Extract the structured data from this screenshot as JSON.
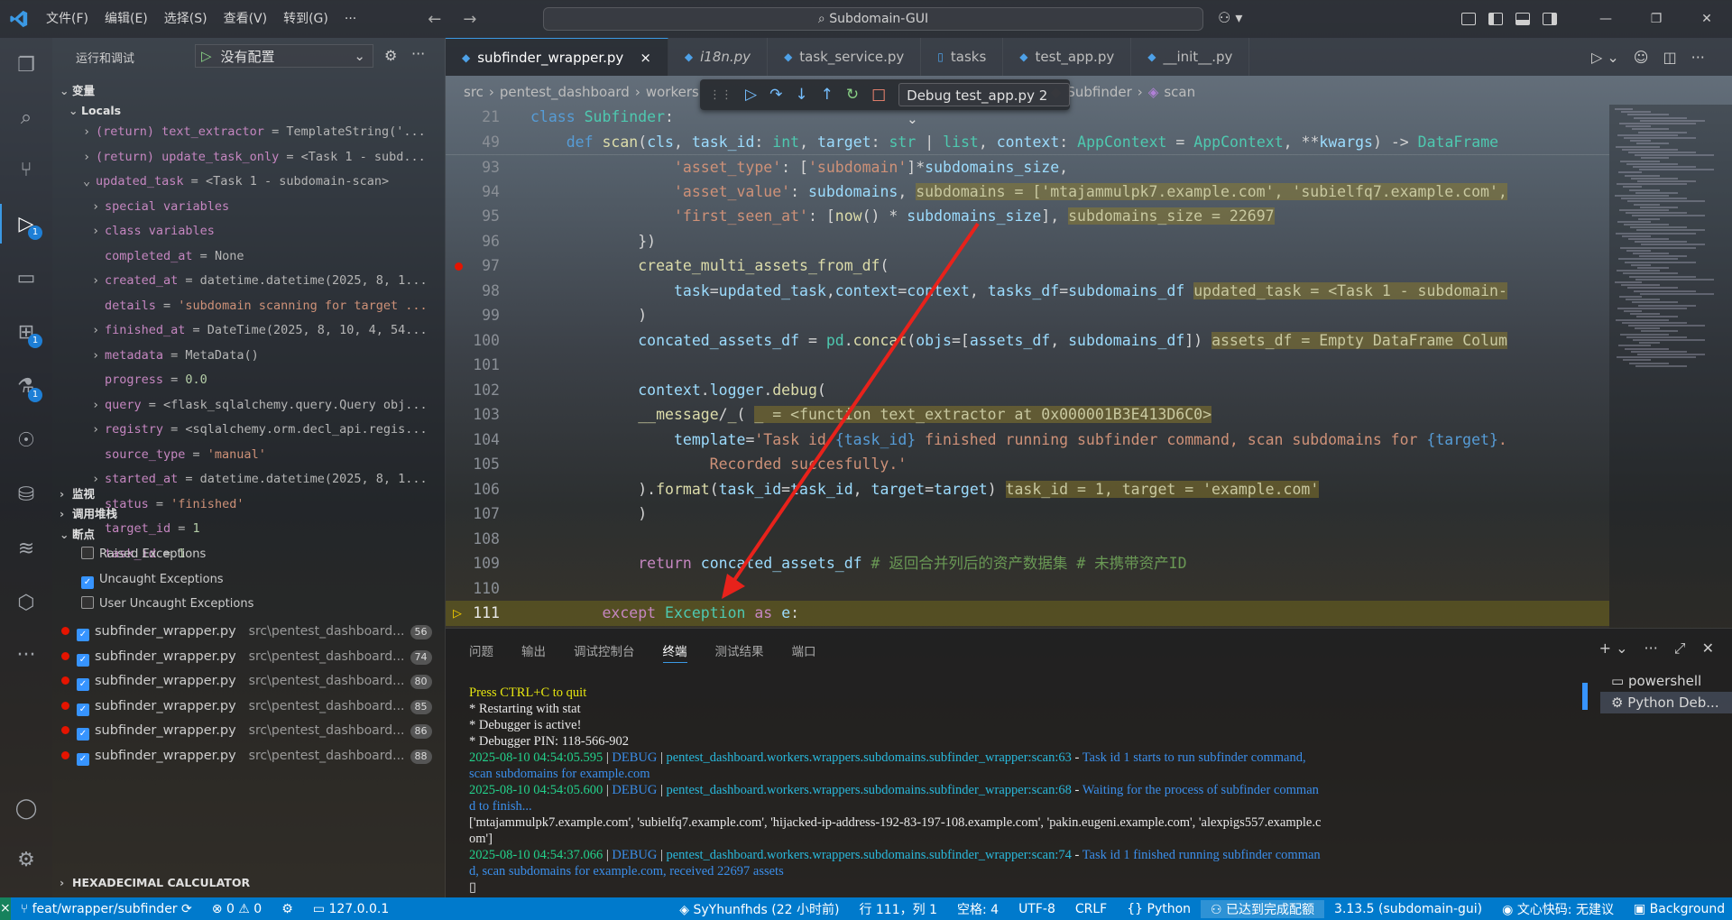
{
  "titlebar": {
    "menu": [
      "文件(F)",
      "编辑(E)",
      "选择(S)",
      "查看(V)",
      "转到(G)",
      "···"
    ],
    "search_text": "Subdomain-GUI"
  },
  "sidebar": {
    "header": "运行和调试",
    "config": "没有配置",
    "variables_section": "变量",
    "locals_label": "Locals",
    "locals": [
      {
        "name": "(return) text_extractor",
        "value": "TemplateString('...",
        "expandable": true,
        "indent": 1
      },
      {
        "name": "(return) update_task_only",
        "value": "<Task 1 - subd...",
        "expandable": true,
        "indent": 1
      },
      {
        "name": "updated_task",
        "value": "<Task 1 - subdomain-scan>",
        "expandable": true,
        "expanded": true,
        "indent": 1
      },
      {
        "name": "special variables",
        "value": "",
        "expandable": true,
        "indent": 2
      },
      {
        "name": "class variables",
        "value": "",
        "expandable": true,
        "indent": 2
      },
      {
        "name": "completed_at",
        "value": "None",
        "expandable": false,
        "indent": 2
      },
      {
        "name": "created_at",
        "value": "datetime.datetime(2025, 8, 1...",
        "expandable": true,
        "indent": 2
      },
      {
        "name": "details",
        "value": "'subdomain scanning for target ...",
        "expandable": false,
        "indent": 2
      },
      {
        "name": "finished_at",
        "value": "DateTime(2025, 8, 10, 4, 54...",
        "expandable": true,
        "indent": 2
      },
      {
        "name": "metadata",
        "value": "MetaData()",
        "expandable": true,
        "indent": 2
      },
      {
        "name": "progress",
        "value": "0.0",
        "expandable": false,
        "indent": 2
      },
      {
        "name": "query",
        "value": "<flask_sqlalchemy.query.Query obj...",
        "expandable": true,
        "indent": 2
      },
      {
        "name": "registry",
        "value": "<sqlalchemy.orm.decl_api.regis...",
        "expandable": true,
        "indent": 2
      },
      {
        "name": "source_type",
        "value": "'manual'",
        "expandable": false,
        "indent": 2
      },
      {
        "name": "started_at",
        "value": "datetime.datetime(2025, 8, 1...",
        "expandable": true,
        "indent": 2
      },
      {
        "name": "status",
        "value": "'finished'",
        "expandable": false,
        "indent": 2
      },
      {
        "name": "target_id",
        "value": "1",
        "expandable": false,
        "indent": 2
      },
      {
        "name": "task_id",
        "value": "1",
        "expandable": false,
        "indent": 2
      }
    ],
    "watch_section": "监视",
    "callstack_section": "调用堆栈",
    "breakpoints_section": "断点",
    "exception_options": [
      {
        "label": "Raised Exceptions",
        "checked": false
      },
      {
        "label": "Uncaught Exceptions",
        "checked": true
      },
      {
        "label": "User Uncaught Exceptions",
        "checked": false
      }
    ],
    "breakpoints": [
      {
        "file": "subfinder_wrapper.py",
        "path": "src\\pentest_dashboard...",
        "line": "56"
      },
      {
        "file": "subfinder_wrapper.py",
        "path": "src\\pentest_dashboard...",
        "line": "74"
      },
      {
        "file": "subfinder_wrapper.py",
        "path": "src\\pentest_dashboard...",
        "line": "80"
      },
      {
        "file": "subfinder_wrapper.py",
        "path": "src\\pentest_dashboard...",
        "line": "85"
      },
      {
        "file": "subfinder_wrapper.py",
        "path": "src\\pentest_dashboard...",
        "line": "86"
      },
      {
        "file": "subfinder_wrapper.py",
        "path": "src\\pentest_dashboard...",
        "line": "88"
      }
    ],
    "hex_section": "HEXADECIMAL CALCULATOR"
  },
  "activity_badges": {
    "debug": "1",
    "extensions": "1",
    "testing": "1"
  },
  "tabs": [
    {
      "label": "subfinder_wrapper.py",
      "active": true,
      "close": "×"
    },
    {
      "label": "i18n.py",
      "active": false
    },
    {
      "label": "task_service.py",
      "active": false
    },
    {
      "label": "tasks",
      "active": false
    },
    {
      "label": "test_app.py",
      "active": false
    },
    {
      "label": "__init__.py",
      "active": false
    }
  ],
  "breadcrumb": {
    "parts": [
      "src",
      "pentest_dashboard",
      "workers"
    ],
    "tail": [
      "Subfinder",
      "scan"
    ]
  },
  "debug_toolbar": {
    "config": "Debug test_app.py 2"
  },
  "code_lines": [
    {
      "n": "21",
      "html": "<span class='kb'>class</span> <span class='cls'>Subfinder</span>:"
    },
    {
      "n": "49",
      "html": "    <span class='kb'>def</span> <span class='fn'>scan</span>(<span class='pm'>cls</span>, <span class='pm'>task_id</span>: <span class='cls'>int</span>, <span class='pm'>target</span>: <span class='cls'>str</span> | <span class='cls'>list</span>, <span class='pm'>context</span>: <span class='cls'>AppContext</span> = <span class='cls'>AppContext</span>, **<span class='pm'>kwargs</span>) -> <span class='cls'>DataFrame</span>"
    },
    {
      "n": "93",
      "html": "                <span class='st'>'asset_type'</span>: [<span class='st'>'subdomain'</span>]*<span class='pm'>subdomains_size</span>,"
    },
    {
      "n": "94",
      "html": "                <span class='st'>'asset_value'</span>: <span class='pm'>subdomains</span>, <span class='inl'>subdomains = ['mtajammulpk7.example.com', 'subielfq7.example.com',</span>"
    },
    {
      "n": "95",
      "html": "                <span class='st'>'first_seen_at'</span>: [<span class='fn'>now</span>() * <span class='pm'>subdomains_size</span>], <span class='inl'>subdomains_size = 22697</span>"
    },
    {
      "n": "96",
      "html": "            })"
    },
    {
      "n": "97",
      "html": "            <span class='fn'>create_multi_assets_from_df</span>(",
      "bp": true
    },
    {
      "n": "98",
      "html": "                <span class='pm'>task</span>=<span class='pm'>updated_task</span>,<span class='pm'>context</span>=<span class='pm'>context</span>, <span class='pm'>tasks_df</span>=<span class='pm'>subdomains_df</span> <span class='inl'>updated_task = &lt;Task 1 - subdomain-</span>"
    },
    {
      "n": "99",
      "html": "            )"
    },
    {
      "n": "100",
      "html": "            <span class='pm'>concated_assets_df</span> = <span class='cls'>pd</span>.<span class='fn'>concat</span>(<span class='pm'>objs</span>=[<span class='pm'>assets_df</span>, <span class='pm'>subdomains_df</span>]) <span class='inl'>assets_df = Empty DataFrame Colum</span>"
    },
    {
      "n": "101",
      "html": ""
    },
    {
      "n": "102",
      "html": "            <span class='pm'>context</span>.<span class='pm'>logger</span>.<span class='fn'>debug</span>("
    },
    {
      "n": "103",
      "html": "            <span class='fn'>__message</span>/<span class='fn'>_</span>( <span class='inl'>_ = &lt;function text_extractor at 0x000001B3E413D6C0&gt;</span>"
    },
    {
      "n": "104",
      "html": "                <span class='pm'>template</span>=<span class='st'>'Task id </span><span class='kb'>{task_id}</span><span class='st'> finished running subfinder command, scan subdomains for </span><span class='kb'>{target}</span><span class='st'>.</span>"
    },
    {
      "n": "105",
      "html": "<span class='st'>                    Recorded succesfully.'</span>"
    },
    {
      "n": "106",
      "html": "            ).<span class='fn'>format</span>(<span class='pm'>task_id</span>=<span class='pm'>task_id</span>, <span class='pm'>target</span>=<span class='pm'>target</span>) <span class='inl'>task_id = 1, target = 'example.com'</span>"
    },
    {
      "n": "107",
      "html": "            )"
    },
    {
      "n": "108",
      "html": ""
    },
    {
      "n": "109",
      "html": "            <span class='kw'>return</span> <span class='pm'>concated_assets_df</span> <span class='cm'># 返回合并列后的资产数据集 # 未携带资产ID</span>"
    },
    {
      "n": "110",
      "html": ""
    },
    {
      "n": "111",
      "html": "        <span class='kw'>except</span> <span class='cls'>Exception</span> <span class='kw'>as</span> <span class='pm'>e</span>:",
      "current": true
    }
  ],
  "panel": {
    "tabs": [
      "问题",
      "输出",
      "调试控制台",
      "终端",
      "测试结果",
      "端口"
    ],
    "active_tab": "终端",
    "terminals": [
      "powershell",
      "Python Deb..."
    ],
    "terminal_lines": [
      {
        "cls": "y",
        "text": "Press CTRL+C to quit"
      },
      {
        "cls": "",
        "text": " * Restarting with stat"
      },
      {
        "cls": "",
        "text": " * Debugger is active!"
      },
      {
        "cls": "",
        "text": " * Debugger PIN: 118-566-902"
      },
      {
        "cls": "mix",
        "ts": "2025-08-10 04:54:05.595",
        "lvl": "DEBUG",
        "mod": "pentest_dashboard.workers.wrappers.subdomains.subfinder_wrapper:scan:63",
        "msg": "Task id 1 starts to run subfinder command,"
      },
      {
        "cls": "b",
        "text": "scan subdomains for example.com"
      },
      {
        "cls": "mix",
        "ts": "2025-08-10 04:54:05.600",
        "lvl": "DEBUG",
        "mod": "pentest_dashboard.workers.wrappers.subdomains.subfinder_wrapper:scan:68",
        "msg": "Waiting for the process of subfinder comman"
      },
      {
        "cls": "b",
        "text": "d to finish..."
      },
      {
        "cls": "",
        "text": "['mtajammulpk7.example.com', 'subielfq7.example.com', 'hijacked-ip-address-192-83-197-108.example.com', 'pakin.eugeni.example.com', 'alexpigs557.example.c"
      },
      {
        "cls": "",
        "text": "om']"
      },
      {
        "cls": "mix",
        "ts": "2025-08-10 04:54:37.066",
        "lvl": "DEBUG",
        "mod": "pentest_dashboard.workers.wrappers.subdomains.subfinder_wrapper:scan:74",
        "msg": "Task id 1 finished running subfinder comman"
      },
      {
        "cls": "b",
        "text": "d,                    scan subdomains for example.com, received 22697 assets"
      }
    ]
  },
  "statusbar": {
    "branch": "feat/wrapper/subfinder",
    "errors": "⊗ 0 ⚠ 0",
    "host": "127.0.0.1",
    "author": "SyYhunfhds (22 小时前)",
    "position": "行 111，列 1",
    "spaces": "空格: 4",
    "encoding": "UTF-8",
    "eol": "CRLF",
    "language": "Python",
    "completion": "已达到完成配额",
    "interpreter": "3.13.5 (subdomain-gui)",
    "quick": "文心快码: 无建议",
    "background": "Background"
  }
}
